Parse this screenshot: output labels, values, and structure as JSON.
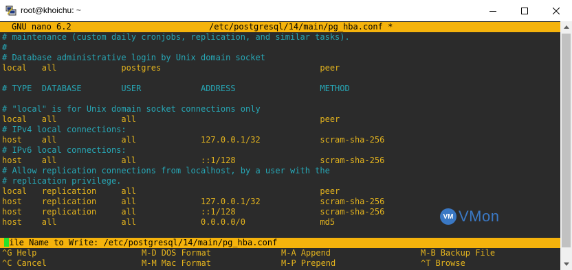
{
  "window": {
    "title": "root@khoichu: ~",
    "minimize_icon": "minimize-icon",
    "maximize_icon": "maximize-icon",
    "close_icon": "close-icon"
  },
  "colors": {
    "terminal_bg": "#2b2b2b",
    "header_bg": "#f5b30c",
    "text_yellow": "#e3b31e",
    "comment_cyan": "#27a8b7",
    "cursor_green": "#25e22a"
  },
  "nano": {
    "version": "GNU nano 6.2",
    "file_path": "/etc/postgresql/14/main/pg_hba.conf *"
  },
  "lines": [
    {
      "text": "# maintenance (custom daily cronjobs, replication, and similar tasks).",
      "comment": true
    },
    {
      "text": "#",
      "comment": true
    },
    {
      "text": "# Database administrative login by Unix domain socket",
      "comment": true
    },
    {
      "text": "local   all             postgres                                peer",
      "comment": false
    },
    {
      "text": "",
      "comment": false
    },
    {
      "text": "# TYPE  DATABASE        USER            ADDRESS                 METHOD",
      "comment": true
    },
    {
      "text": "",
      "comment": false
    },
    {
      "text": "# \"local\" is for Unix domain socket connections only",
      "comment": true
    },
    {
      "text": "local   all             all                                     peer",
      "comment": false
    },
    {
      "text": "# IPv4 local connections:",
      "comment": true
    },
    {
      "text": "host    all             all             127.0.0.1/32            scram-sha-256",
      "comment": false
    },
    {
      "text": "# IPv6 local connections:",
      "comment": true
    },
    {
      "text": "host    all             all             ::1/128                 scram-sha-256",
      "comment": false
    },
    {
      "text": "# Allow replication connections from localhost, by a user with the",
      "comment": true
    },
    {
      "text": "# replication privilege.",
      "comment": true
    },
    {
      "text": "local   replication     all                                     peer",
      "comment": false
    },
    {
      "text": "host    replication     all             127.0.0.1/32            scram-sha-256",
      "comment": false
    },
    {
      "text": "host    replication     all             ::1/128                 scram-sha-256",
      "comment": false
    },
    {
      "text": "host    all             all             0.0.0.0/0               md5",
      "comment": false
    }
  ],
  "prompt": {
    "text": "File Name to Write: /etc/postgresql/14/main/pg_hba.conf"
  },
  "shortcuts": {
    "row1": [
      {
        "key": "^G",
        "label": "Help"
      },
      {
        "key": "M-D",
        "label": "DOS Format"
      },
      {
        "key": "M-A",
        "label": "Append"
      },
      {
        "key": "M-B",
        "label": "Backup File"
      }
    ],
    "row2": [
      {
        "key": "^C",
        "label": "Cancel"
      },
      {
        "key": "M-M",
        "label": "Mac Format"
      },
      {
        "key": "M-P",
        "label": "Prepend"
      },
      {
        "key": "^T",
        "label": "Browse"
      }
    ]
  },
  "watermark": {
    "badge": "VM",
    "text": "VMon"
  }
}
